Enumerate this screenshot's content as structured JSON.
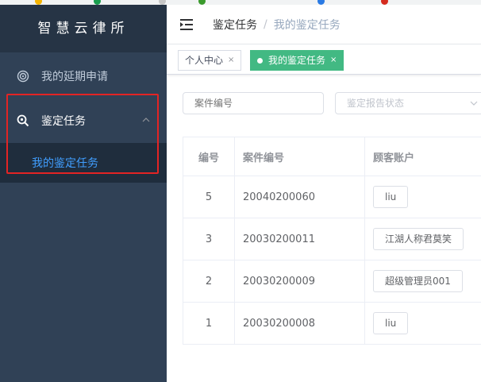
{
  "sidebar": {
    "brand": "智慧云律所",
    "items": [
      {
        "label": "我的延期申请",
        "icon": "target-icon"
      },
      {
        "label": "鉴定任务",
        "icon": "search-icon",
        "expanded": true,
        "children": [
          {
            "label": "我的鉴定任务",
            "active": true
          }
        ]
      }
    ]
  },
  "navbar": {
    "breadcrumb": [
      "鉴定任务",
      "我的鉴定任务"
    ],
    "breadcrumb_separator": "/"
  },
  "tags": [
    {
      "label": "个人中心",
      "close": "×",
      "active": false
    },
    {
      "label": "我的鉴定任务",
      "close": "×",
      "active": true
    }
  ],
  "filters": {
    "case_no_placeholder": "案件编号",
    "report_status_placeholder": "鉴定报告状态"
  },
  "table": {
    "columns": [
      "编号",
      "案件编号",
      "顾客账户"
    ],
    "rows": [
      {
        "id": "5",
        "case_no": "20040200060",
        "account": "liu"
      },
      {
        "id": "3",
        "case_no": "20030200011",
        "account": "江湖人称君莫笑"
      },
      {
        "id": "2",
        "case_no": "20030200009",
        "account": "超级管理员001"
      },
      {
        "id": "1",
        "case_no": "20030200008",
        "account": "liu"
      }
    ]
  },
  "colors": {
    "sidebar_bg": "#304156",
    "brand_bg": "#263445",
    "submenu_bg": "#1f2d3d",
    "active_text": "#409eff",
    "active_tag": "#42b983",
    "highlight_border": "#e32424"
  }
}
